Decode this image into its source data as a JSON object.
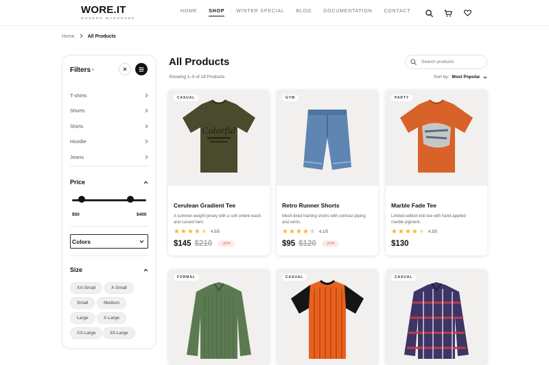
{
  "brand": {
    "name": "WORE.IT",
    "tagline": "MODERN WARDROBE"
  },
  "nav": [
    "HOME",
    "SHOP",
    "WINTER SPECIAL",
    "BLOG",
    "DOCUMENTATION",
    "CONTACT"
  ],
  "nav_active": "SHOP",
  "header_icons": [
    "search-icon",
    "cart-icon",
    "heart-icon"
  ],
  "breadcrumb": {
    "home": "Home",
    "current": "All Products"
  },
  "sidebar": {
    "title": "Filters",
    "categories": [
      "T-shirts",
      "Shorts",
      "Shirts",
      "Hoodie",
      "Jeans"
    ],
    "price": {
      "title": "Price",
      "min": "$50",
      "max": "$400",
      "low_fraction": 0.13,
      "high_fraction": 0.79
    },
    "colors": {
      "title": "Colors"
    },
    "size": {
      "title": "Size",
      "options": [
        "XX-Small",
        "X-Small",
        "Small",
        "Medium",
        "Large",
        "X-Large",
        "XX-Large",
        "3X-Large"
      ]
    }
  },
  "main": {
    "title": "All Products",
    "search_placeholder": "Search products",
    "showing": "Showing 1–9 of 18 Products",
    "sort_label": "Sort by:",
    "sort_value": "Most Popular"
  },
  "products": [
    {
      "tag": "CASUAL",
      "name": "Cerulean Gradient Tee",
      "desc": "A summer-weight jersey with a soft ombré wash and curved hem.",
      "rating": 4.5,
      "rating_text": "4.5/5",
      "price": "$145",
      "old_price": "$210",
      "discount": "-31%",
      "color": "#4a4a2c",
      "kind": "tee"
    },
    {
      "tag": "GYM",
      "name": "Retro Runner Shorts",
      "desc": "Mesh-lined training shorts with contrast piping and vents.",
      "rating": 4.1,
      "rating_text": "4.1/5",
      "price": "$95",
      "old_price": "$120",
      "discount": "-21%",
      "color": "#5f86b3",
      "kind": "shorts"
    },
    {
      "tag": "PARTY",
      "name": "Marble Fade Tee",
      "desc": "Limited-edition knit tee with hand-applied marble pigment.",
      "rating": 4.3,
      "rating_text": "4.3/5",
      "price": "$130",
      "old_price": "",
      "discount": "",
      "color": "#d8622a",
      "kind": "tee"
    },
    {
      "tag": "FORMAL",
      "color": "#5c7a52",
      "kind": "shirt"
    },
    {
      "tag": "CASUAL",
      "color": "#e8611f",
      "kind": "ringer"
    },
    {
      "tag": "CASUAL",
      "color": "#3d3566",
      "kind": "plaid"
    }
  ]
}
